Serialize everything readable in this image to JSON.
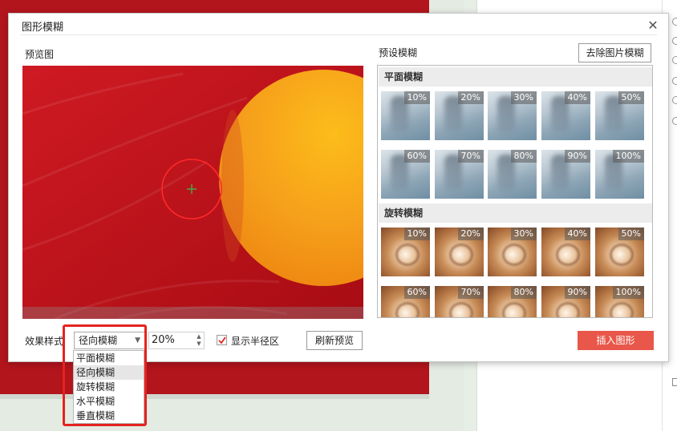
{
  "dialog": {
    "title": "图形模糊",
    "close_glyph": "✕",
    "preview_label": "预览图",
    "preset_label": "预设模糊",
    "remove_button": "去除图片模糊"
  },
  "presets": {
    "flat": {
      "header": "平面模糊",
      "items": [
        "10%",
        "20%",
        "30%",
        "40%",
        "50%",
        "60%",
        "70%",
        "80%",
        "90%",
        "100%"
      ]
    },
    "rotate": {
      "header": "旋转模糊",
      "items": [
        "10%",
        "20%",
        "30%",
        "40%",
        "50%",
        "60%",
        "70%",
        "80%",
        "90%",
        "100%"
      ]
    }
  },
  "footer": {
    "effect_label": "效果样式",
    "effect_selected": "径向模糊",
    "amount_value": "20%",
    "show_radius_label": "显示半径区",
    "show_radius_checked": true,
    "refresh_button": "刷新预览",
    "insert_button": "插入图形"
  },
  "dropdown": {
    "options": [
      "平面模糊",
      "径向模糊",
      "旋转模糊",
      "水平模糊",
      "垂直模糊"
    ],
    "selected_index": 1
  },
  "colors": {
    "accent": "#e8574a",
    "highlight": "#e5231f",
    "slide_red": "#b3151d",
    "preview_orange": "#f7a21b"
  },
  "icons": {
    "close": "close-icon",
    "dropdown_arrow": "chevron-down-icon",
    "checkbox": "check-icon"
  }
}
